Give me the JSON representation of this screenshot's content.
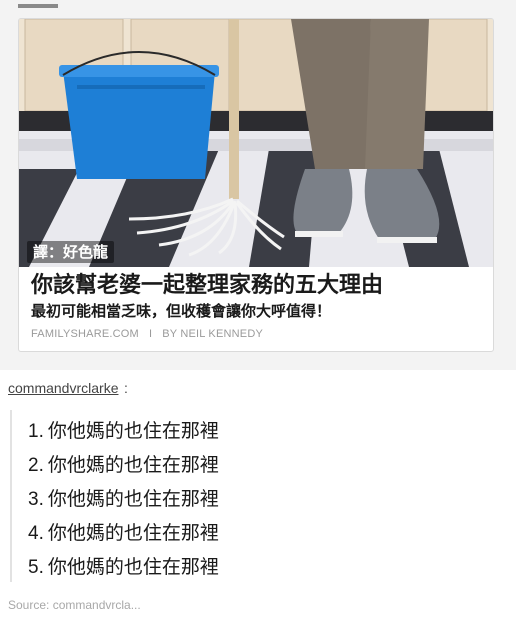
{
  "card": {
    "translator_tag": "譯：好色龍",
    "headline": "你該幫老婆一起整理家務的五大理由",
    "subtitle": "最初可能相當乏味，但收穫會讓你大呼值得！",
    "source_domain": "FAMILYSHARE.COM",
    "separator": "I",
    "author": "BY NEIL KENNEDY"
  },
  "post": {
    "username": "commandvrclarke",
    "colon": ":",
    "replies": [
      {
        "num": "1.",
        "text": "你他媽的也住在那裡"
      },
      {
        "num": "2.",
        "text": "你他媽的也住在那裡"
      },
      {
        "num": "3.",
        "text": "你他媽的也住在那裡"
      },
      {
        "num": "4.",
        "text": "你他媽的也住在那裡"
      },
      {
        "num": "5.",
        "text": "你他媽的也住在那裡"
      }
    ]
  },
  "source": {
    "label": "Source: commandvrcla..."
  },
  "colors": {
    "bucket": "#1e7fd6",
    "floor_dark": "#3b3d45",
    "floor_light": "#e9e9ee",
    "pants": "#7d7266",
    "shoe": "#7b8088"
  },
  "photo_subject": "man-standing-with-mop-and-bucket-illustration"
}
